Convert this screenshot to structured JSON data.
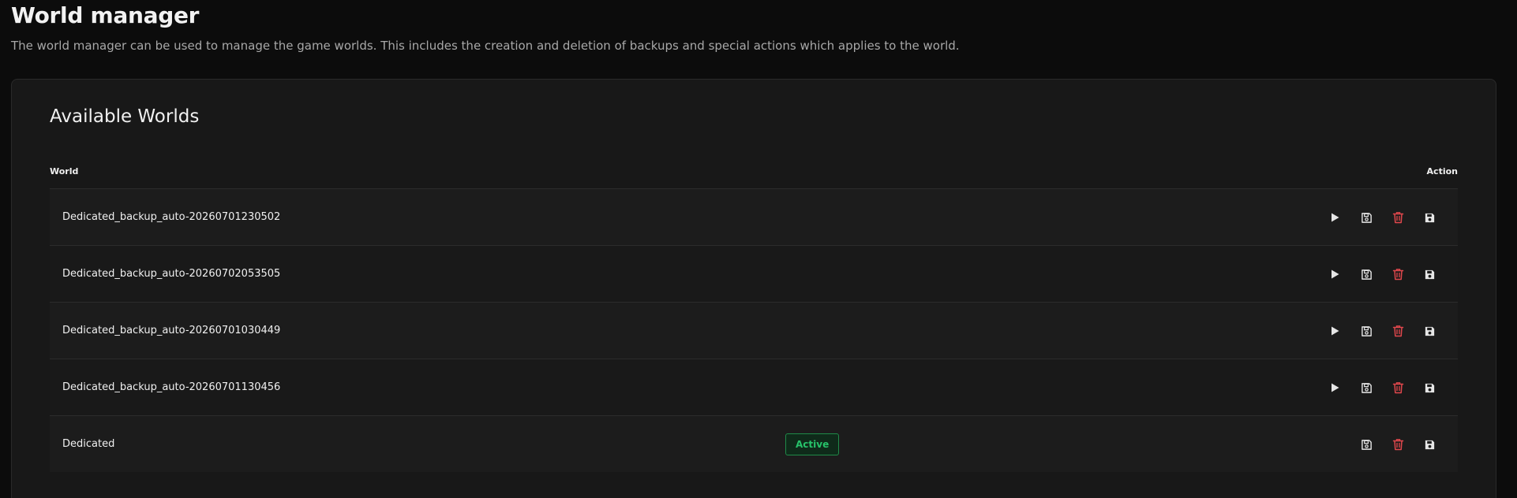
{
  "header": {
    "title": "World manager",
    "description": "The world manager can be used to manage the game worlds. This includes the creation and deletion of backups and special actions which applies to the world."
  },
  "card": {
    "title": "Available Worlds",
    "columns": {
      "world": "World",
      "action": "Action"
    }
  },
  "worlds": [
    {
      "name": "Dedicated_backup_auto-20260701230502",
      "active": false,
      "status": ""
    },
    {
      "name": "Dedicated_backup_auto-20260702053505",
      "active": false,
      "status": ""
    },
    {
      "name": "Dedicated_backup_auto-20260701030449",
      "active": false,
      "status": ""
    },
    {
      "name": "Dedicated_backup_auto-20260701130456",
      "active": false,
      "status": ""
    },
    {
      "name": "Dedicated",
      "active": true,
      "status": "Active"
    }
  ],
  "icons": {
    "play": "play-icon",
    "backup": "floppy-outline-icon",
    "delete": "trash-icon",
    "save": "floppy-solid-icon"
  },
  "colors": {
    "background": "#0c0c0c",
    "card": "#181818",
    "danger": "#e0474c",
    "active": "#27c26a"
  }
}
